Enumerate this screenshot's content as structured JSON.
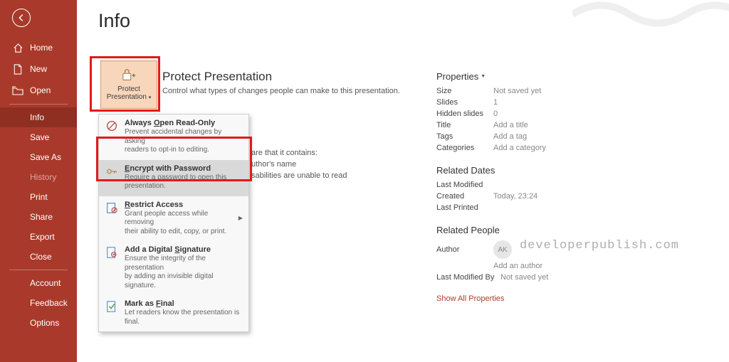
{
  "page_title": "Info",
  "sidebar": {
    "items": [
      {
        "label": "Home",
        "id": "home"
      },
      {
        "label": "New",
        "id": "new"
      },
      {
        "label": "Open",
        "id": "open"
      },
      {
        "label": "Info",
        "id": "info",
        "active": true
      },
      {
        "label": "Save",
        "id": "save"
      },
      {
        "label": "Save As",
        "id": "saveas"
      },
      {
        "label": "History",
        "id": "history",
        "disabled": true
      },
      {
        "label": "Print",
        "id": "print"
      },
      {
        "label": "Share",
        "id": "share"
      },
      {
        "label": "Export",
        "id": "export"
      },
      {
        "label": "Close",
        "id": "close"
      },
      {
        "label": "Account",
        "id": "account"
      },
      {
        "label": "Feedback",
        "id": "feedback"
      },
      {
        "label": "Options",
        "id": "options"
      }
    ]
  },
  "protect": {
    "button_label_line1": "Protect",
    "button_label_line2": "Presentation",
    "heading": "Protect Presentation",
    "desc": "Control what types of changes people can make to this presentation.",
    "menu": [
      {
        "title": "Always Open Read-Only",
        "key": "O",
        "desc1": "Prevent accidental changes by asking",
        "desc2": "readers to opt-in to editing."
      },
      {
        "title": "Encrypt with Password",
        "key": "E",
        "desc1": "Require a password to open this",
        "desc2": "presentation."
      },
      {
        "title": "Restrict Access",
        "key": "R",
        "desc1": "Grant people access while removing",
        "desc2": "their ability to edit, copy, or print."
      },
      {
        "title": "Add a Digital Signature",
        "key": "S",
        "desc1": "Ensure the integrity of the presentation",
        "desc2": "by adding an invisible digital signature."
      },
      {
        "title": "Mark as Final",
        "key": "F",
        "desc1": "Let readers know the presentation is",
        "desc2": "final."
      }
    ]
  },
  "behind": {
    "l1": "are that it contains:",
    "l2": "uthor's name",
    "l3": "sabilities are unable to read"
  },
  "properties": {
    "header": "Properties",
    "rows": [
      {
        "label": "Size",
        "value": "Not saved yet"
      },
      {
        "label": "Slides",
        "value": "1"
      },
      {
        "label": "Hidden slides",
        "value": "0"
      },
      {
        "label": "Title",
        "value": "Add a title",
        "link": true
      },
      {
        "label": "Tags",
        "value": "Add a tag",
        "link": true
      },
      {
        "label": "Categories",
        "value": "Add a category",
        "link": true
      }
    ],
    "dates_header": "Related Dates",
    "dates": [
      {
        "label": "Last Modified",
        "value": ""
      },
      {
        "label": "Created",
        "value": "Today, 23:24"
      },
      {
        "label": "Last Printed",
        "value": ""
      }
    ],
    "people_header": "Related People",
    "author_label": "Author",
    "author_initials": "AK",
    "add_author": "Add an author",
    "modified_by_label": "Last Modified By",
    "modified_by_value": "Not saved yet",
    "show_all": "Show All Properties"
  },
  "watermark": "developerpublish.com"
}
